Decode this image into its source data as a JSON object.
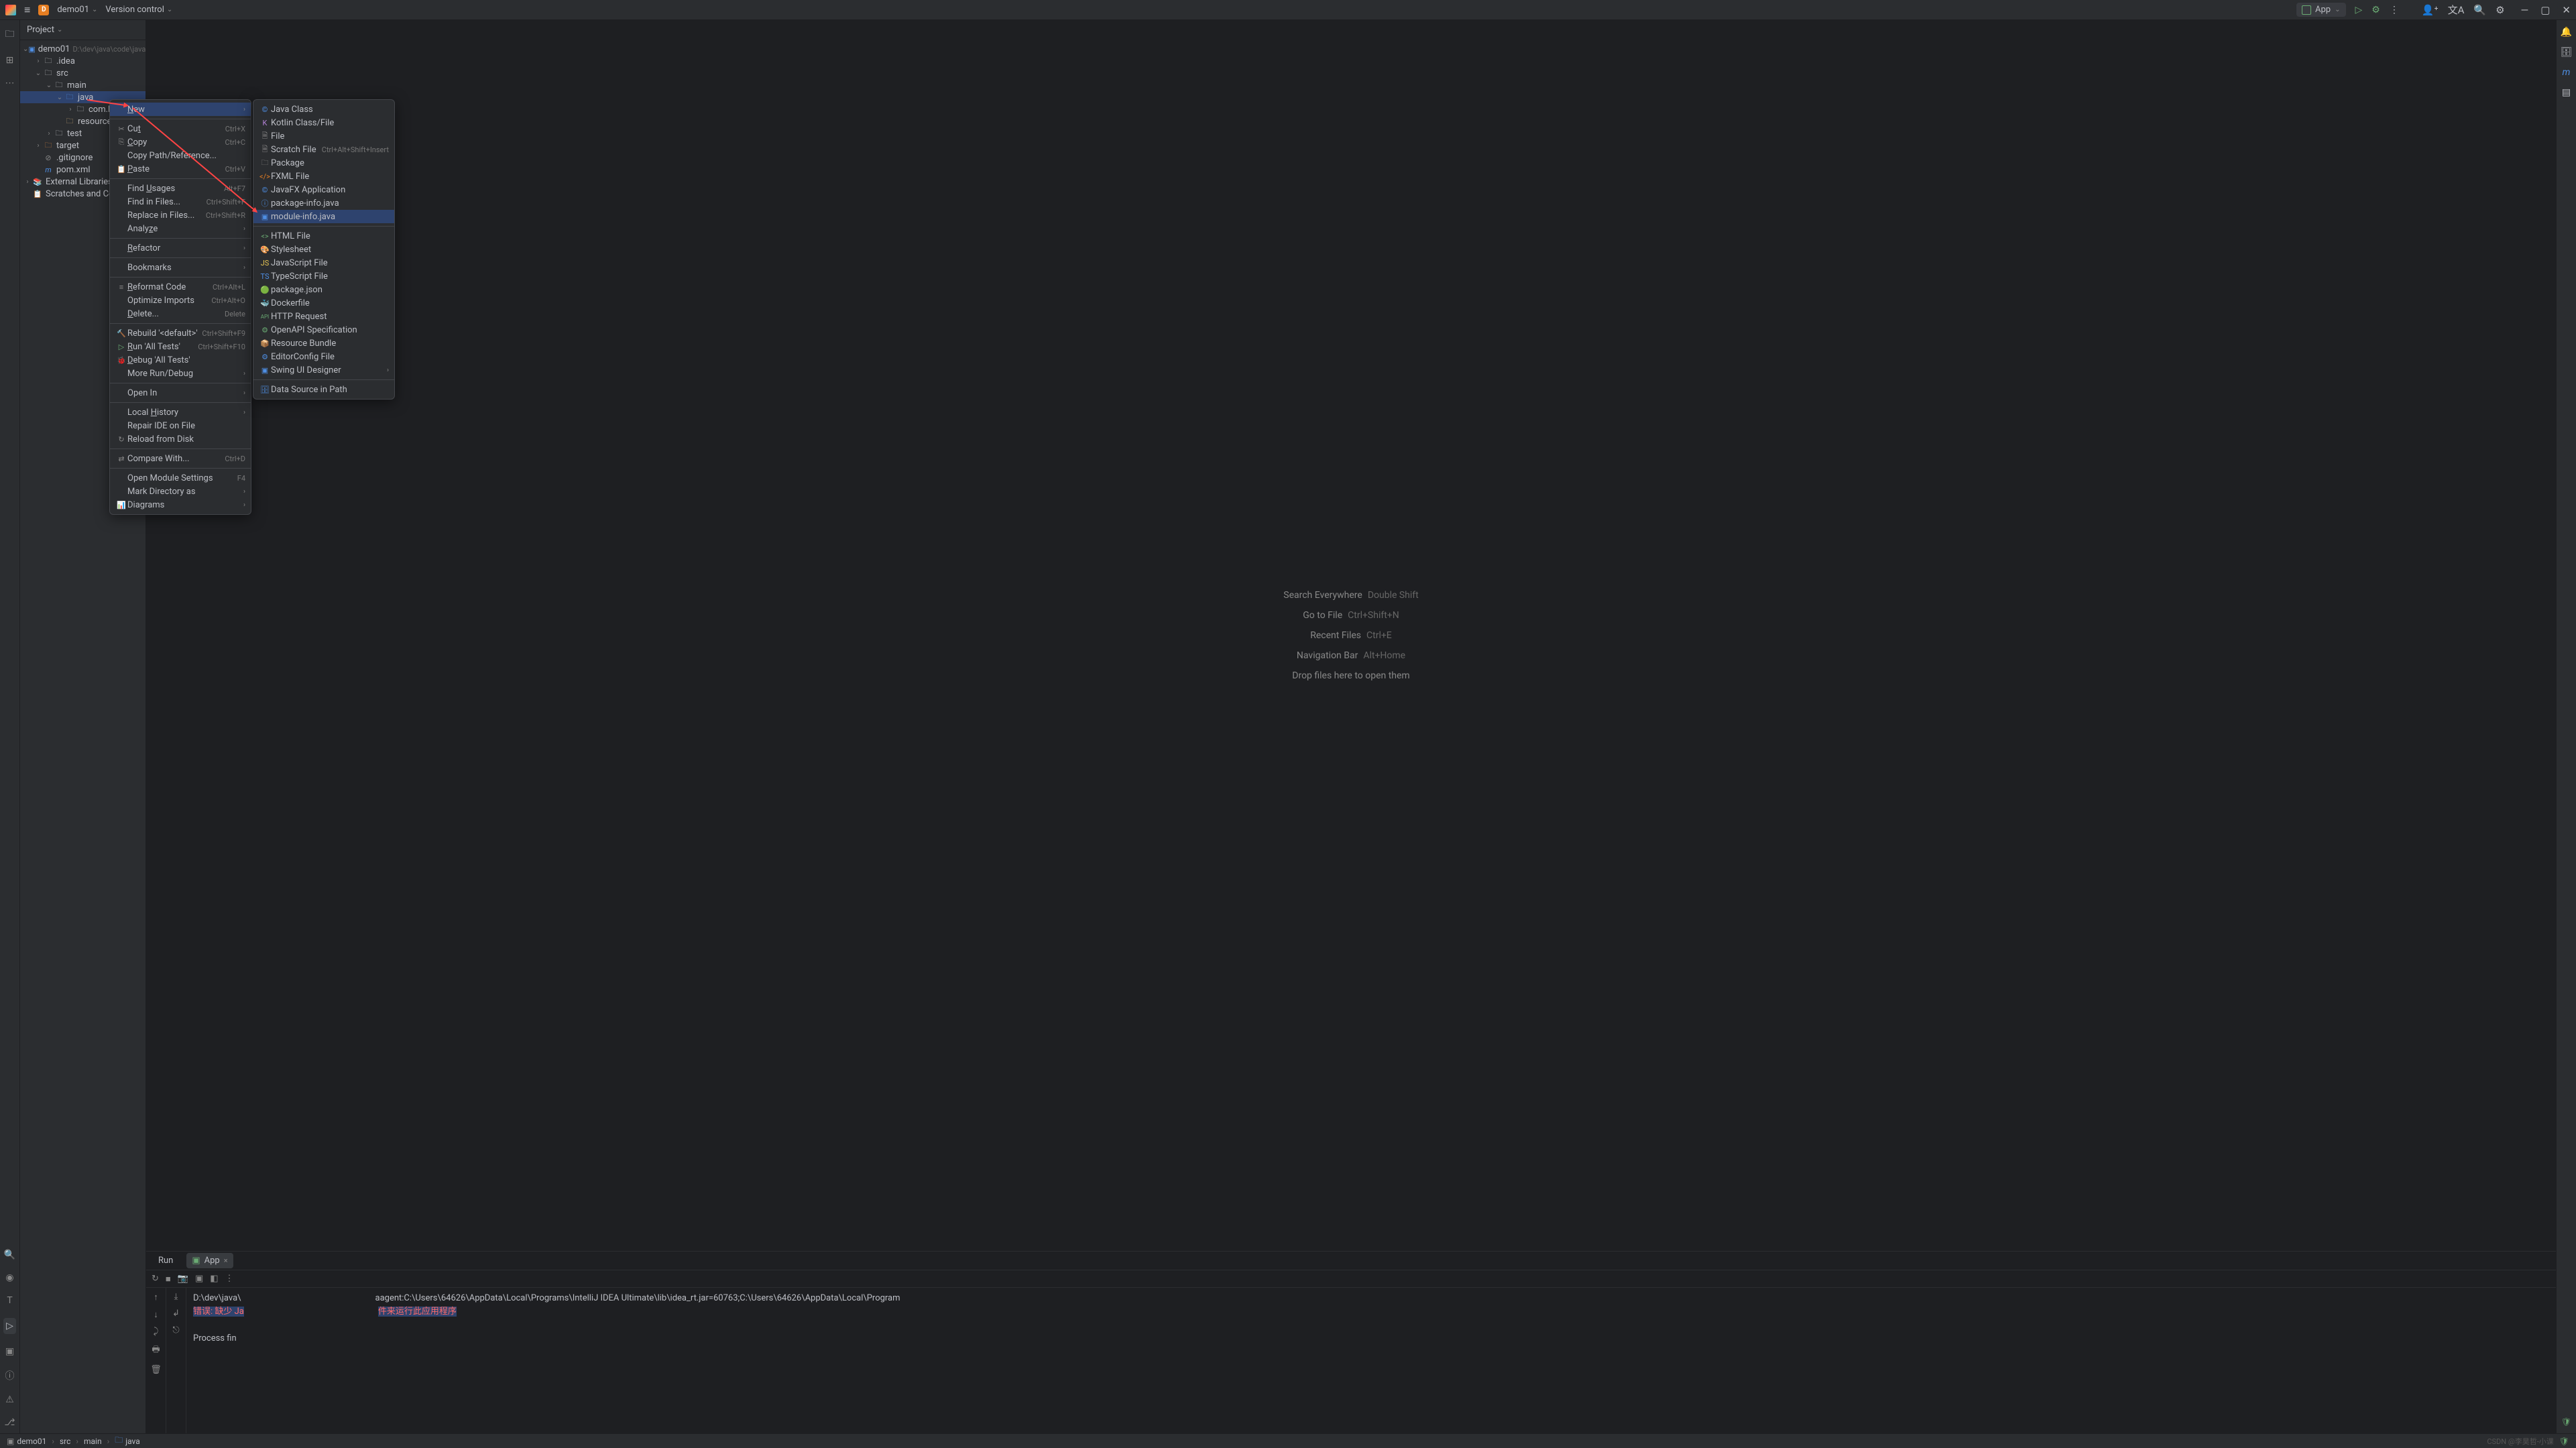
{
  "titlebar": {
    "project_name": "demo01",
    "version_control": "Version control",
    "run_config": "App"
  },
  "sidebar": {
    "title": "Project"
  },
  "tree": {
    "root": "demo01",
    "root_path": "D:\\dev\\java\\code\\java",
    "idea": ".idea",
    "src": "src",
    "main": "main",
    "java": "java",
    "com_lih": "com.lih",
    "resources": "resources",
    "test": "test",
    "target": "target",
    "gitignore": ".gitignore",
    "pom": "pom.xml",
    "ext_lib": "External Libraries",
    "scratches": "Scratches and Consoles"
  },
  "welcome": {
    "search": "Search Everywhere",
    "search_key": "Double Shift",
    "goto_file": "Go to File",
    "goto_file_key": "Ctrl+Shift+N",
    "recent": "Recent Files",
    "recent_key": "Ctrl+E",
    "nav": "Navigation Bar",
    "nav_key": "Alt+Home",
    "drop": "Drop files here to open them"
  },
  "context_menu": {
    "new": "New",
    "cut": "Cut",
    "cut_key": "Ctrl+X",
    "copy": "Copy",
    "copy_key": "Ctrl+C",
    "copy_path": "Copy Path/Reference...",
    "paste": "Paste",
    "paste_key": "Ctrl+V",
    "find_usages": "Find Usages",
    "find_usages_key": "Alt+F7",
    "find_in_files": "Find in Files...",
    "find_in_files_key": "Ctrl+Shift+F",
    "replace_in_files": "Replace in Files...",
    "replace_in_files_key": "Ctrl+Shift+R",
    "analyze": "Analyze",
    "refactor": "Refactor",
    "bookmarks": "Bookmarks",
    "reformat": "Reformat Code",
    "reformat_key": "Ctrl+Alt+L",
    "optimize": "Optimize Imports",
    "optimize_key": "Ctrl+Alt+O",
    "delete": "Delete...",
    "delete_key": "Delete",
    "rebuild": "Rebuild '<default>'",
    "rebuild_key": "Ctrl+Shift+F9",
    "run_all": "Run 'All Tests'",
    "run_all_key": "Ctrl+Shift+F10",
    "debug_all": "Debug 'All Tests'",
    "more_run": "More Run/Debug",
    "open_in": "Open In",
    "local_hist": "Local History",
    "repair": "Repair IDE on File",
    "reload": "Reload from Disk",
    "compare": "Compare With...",
    "compare_key": "Ctrl+D",
    "module_settings": "Open Module Settings",
    "module_settings_key": "F4",
    "mark_dir": "Mark Directory as",
    "diagrams": "Diagrams"
  },
  "new_menu": {
    "java_class": "Java Class",
    "kotlin": "Kotlin Class/File",
    "file": "File",
    "scratch": "Scratch File",
    "scratch_key": "Ctrl+Alt+Shift+Insert",
    "package": "Package",
    "fxml": "FXML File",
    "javafx": "JavaFX Application",
    "pkg_info": "package-info.java",
    "mod_info": "module-info.java",
    "html": "HTML File",
    "stylesheet": "Stylesheet",
    "js": "JavaScript File",
    "ts": "TypeScript File",
    "pkg_json": "package.json",
    "dockerfile": "Dockerfile",
    "http": "HTTP Request",
    "openapi": "OpenAPI Specification",
    "resource_bundle": "Resource Bundle",
    "editorconfig": "EditorConfig File",
    "swing": "Swing UI Designer",
    "datasource": "Data Source in Path"
  },
  "run_panel": {
    "tab_run": "Run",
    "tab_app": "App",
    "line1": "D:\\dev\\java\\",
    "line1_rest": "aagent:C:\\Users\\64626\\AppData\\Local\\Programs\\IntelliJ IDEA Ultimate\\lib\\idea_rt.jar=60763;C:\\Users\\64626\\AppData\\Local\\Program",
    "err_prefix": "错误: 缺少 Ja",
    "err_suffix": "件来运行此应用程序",
    "exit": "Process fin"
  },
  "statusbar": {
    "crumb1": "demo01",
    "crumb2": "src",
    "crumb3": "main",
    "crumb4": "java",
    "watermark": "CSDN @李昊哲-小课"
  }
}
